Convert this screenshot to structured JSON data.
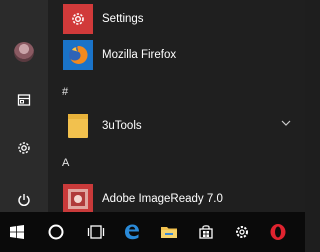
{
  "start_menu": {
    "apps": [
      {
        "label": "Settings",
        "icon": "settings-gear-icon",
        "tile_color": "#d13a3a"
      },
      {
        "label": "Mozilla Firefox",
        "icon": "firefox-icon",
        "tile_color": "#1a73c8"
      },
      {
        "label": "3uTools",
        "icon": "folder-icon",
        "tile_color": "#f2c14e"
      },
      {
        "label": "Adobe ImageReady 7.0",
        "icon": "adobe-imageready-icon",
        "tile_color": "#d13a3a"
      }
    ],
    "sections": [
      "#",
      "A"
    ]
  },
  "rail": {
    "items": [
      "user-avatar",
      "documents-icon",
      "settings-icon",
      "power-icon"
    ]
  },
  "taskbar": {
    "items": [
      "windows-start-icon",
      "cortana-icon",
      "task-view-icon",
      "edge-icon",
      "file-explorer-icon",
      "store-icon",
      "settings-icon",
      "opera-icon"
    ]
  },
  "colors": {
    "accent": "#d13a3a",
    "taskbar_bg": "#0a0a0a",
    "menu_bg": "#1f1f1f"
  }
}
